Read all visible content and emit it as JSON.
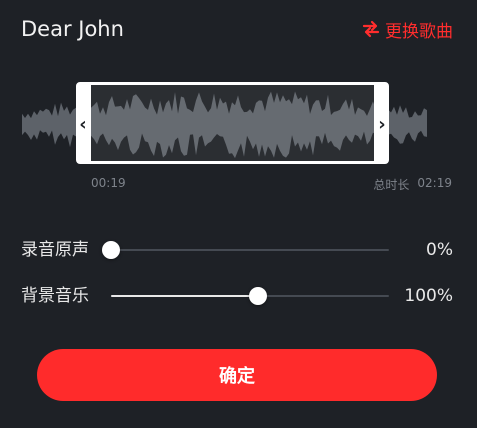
{
  "song": {
    "title": "Dear John",
    "change_label": "更换歌曲"
  },
  "waveform": {
    "start_time": "00:19",
    "total_label": "总时长",
    "total_time": "02:19"
  },
  "sliders": [
    {
      "label": "录音原声",
      "value_text": "0%",
      "level": 0.0
    },
    {
      "label": "背景音乐",
      "value_text": "100%",
      "level": 0.53
    }
  ],
  "confirm_label": "确定",
  "colors": {
    "background": "#1e2126",
    "accent": "#ff2b2b",
    "wave": "#5d6269"
  },
  "icons": {
    "change": "swap-arrows-icon",
    "handle_left": "chevron-left-icon",
    "handle_right": "chevron-right-icon"
  }
}
